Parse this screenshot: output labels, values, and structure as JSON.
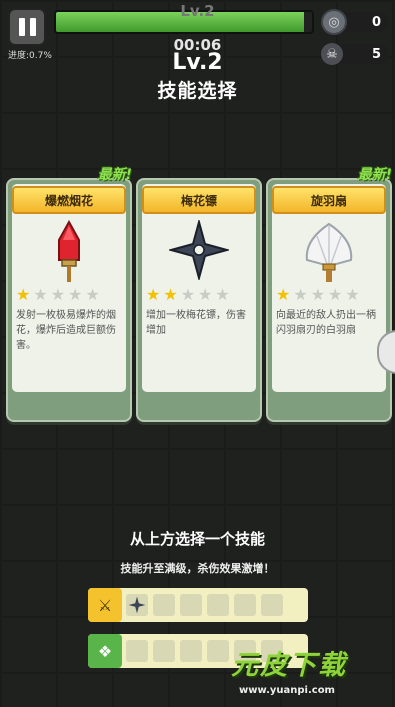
{
  "hud": {
    "level_small": "Lv.2",
    "timer": "00:06",
    "progress_text": "进度:0.7%",
    "xp_fraction": 0.97,
    "coins": "0",
    "kills": "5"
  },
  "header": {
    "level": "Lv.2",
    "title": "技能选择"
  },
  "cards": [
    {
      "new_tag": "",
      "name": "爆燃烟花",
      "stars_filled": 1,
      "stars_total": 5,
      "description": "发射一枚极易爆炸的烟花，爆炸后造成巨额伤害。"
    },
    {
      "new_tag": "",
      "name": "梅花镖",
      "stars_filled": 2,
      "stars_total": 5,
      "description": "增加一枚梅花镖，伤害增加"
    },
    {
      "new_tag": "最新!",
      "name": "旋羽扇",
      "stars_filled": 1,
      "stars_total": 5,
      "description": "向最近的敌人扔出一柄闪羽扇刃的白羽扇"
    }
  ],
  "first_card_new_tag": "最新!",
  "bottom": {
    "choose_title": "从上方选择一个技能",
    "choose_sub": "技能升至满级，杀伤效果激增！"
  },
  "watermark": {
    "title": "元皮下载",
    "url": "www.yuanpi.com"
  },
  "colors": {
    "banner": "#f2b52b",
    "new_tag": "#8fe24f",
    "star_on": "#f2c200",
    "xp_fill": "#5bb83f",
    "slot_bg": "#f2efc1"
  },
  "icons": [
    "pause-icon",
    "coin-icon",
    "skull-icon",
    "firework-rocket-icon",
    "shuriken-icon",
    "feather-fan-icon",
    "weapon-slot-icon",
    "passive-slot-icon"
  ]
}
